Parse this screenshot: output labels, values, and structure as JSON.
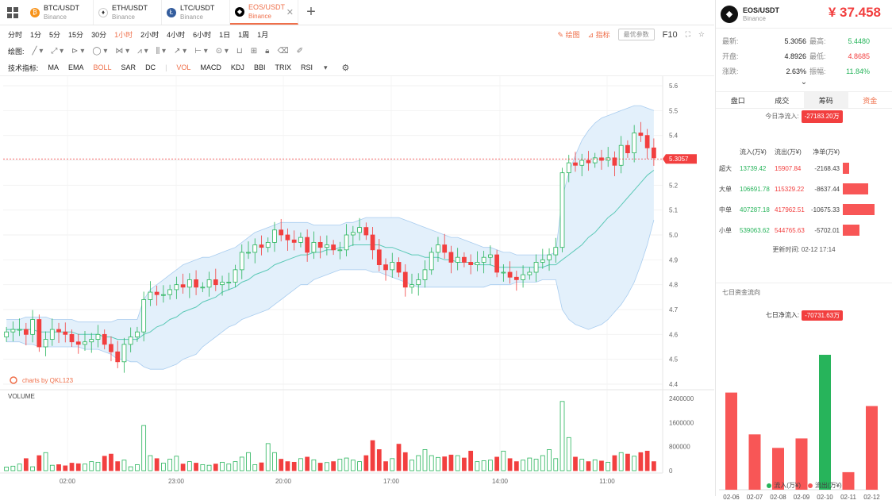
{
  "tabs": [
    {
      "symbol": "BTC/USDT",
      "exchange": "Binance",
      "coin": "₿",
      "color": "#f7931a"
    },
    {
      "symbol": "ETH/USDT",
      "exchange": "Binance",
      "coin": "♦",
      "color": "#ffffff"
    },
    {
      "symbol": "LTC/USDT",
      "exchange": "Binance",
      "coin": "Ł",
      "color": "#345d9d"
    },
    {
      "symbol": "EOS/USDT",
      "exchange": "Binance",
      "coin": "◆",
      "color": "#000000"
    }
  ],
  "intervals": [
    "分时",
    "1分",
    "5分",
    "15分",
    "30分",
    "1小时",
    "2小时",
    "4小时",
    "6小时",
    "1日",
    "1周",
    "1月"
  ],
  "active_interval": "1小时",
  "toolbar_right": {
    "draw": "绘图",
    "indicator": "指标",
    "pref": "最优参数",
    "f10": "F10"
  },
  "draw_label": "绘图:",
  "indicator_label": "技术指标:",
  "indicators": [
    "MA",
    "EMA",
    "BOLL",
    "SAR",
    "DC",
    "VOL",
    "MACD",
    "KDJ",
    "BBI",
    "TRIX",
    "RSI"
  ],
  "active_indicator": "BOLL",
  "chart_data": {
    "type": "candlestick",
    "y_ticks": [
      5.6,
      5.5,
      5.4,
      5.3,
      5.2,
      5.1,
      5.0,
      4.9,
      4.8,
      4.7,
      4.6,
      4.5,
      4.4
    ],
    "ylim": [
      4.4,
      5.6
    ],
    "x_ticks": [
      "02:00",
      "23:00",
      "20:00",
      "17:00",
      "14:00",
      "11:00"
    ],
    "current_price": "5.3057",
    "watermark": "charts by QKL123",
    "volume_label": "VOLUME",
    "volume_ticks": [
      "2400000",
      "1600000",
      "800000",
      "0"
    ],
    "volume_max": 2400000,
    "closes": [
      4.61,
      4.62,
      4.62,
      4.6,
      4.66,
      4.55,
      4.58,
      4.62,
      4.61,
      4.6,
      4.57,
      4.56,
      4.57,
      4.58,
      4.6,
      4.56,
      4.53,
      4.49,
      4.56,
      4.59,
      4.61,
      4.74,
      4.77,
      4.76,
      4.76,
      4.78,
      4.8,
      4.79,
      4.82,
      4.79,
      4.79,
      4.82,
      4.8,
      4.81,
      4.81,
      4.86,
      4.93,
      4.93,
      4.96,
      4.95,
      4.97,
      5.02,
      5.0,
      4.98,
      4.97,
      4.99,
      4.93,
      4.97,
      4.95,
      4.96,
      4.94,
      4.94,
      5.0,
      5.01,
      5.03,
      5.0,
      4.94,
      4.88,
      4.86,
      4.89,
      4.85,
      4.79,
      4.8,
      4.82,
      4.86,
      4.93,
      4.96,
      4.93,
      4.89,
      4.91,
      4.89,
      4.88,
      4.89,
      4.91,
      4.92,
      4.85,
      4.85,
      4.83,
      4.82,
      4.84,
      4.85,
      4.89,
      4.9,
      4.92,
      4.95,
      5.25,
      5.29,
      5.28,
      5.3,
      5.29,
      5.31,
      5.3,
      5.31,
      5.28,
      5.36,
      5.33,
      5.41,
      5.4,
      5.35,
      5.31
    ],
    "opens": [
      4.59,
      4.61,
      4.62,
      4.62,
      4.6,
      4.66,
      4.55,
      4.58,
      4.62,
      4.61,
      4.6,
      4.57,
      4.56,
      4.57,
      4.58,
      4.6,
      4.56,
      4.53,
      4.49,
      4.56,
      4.59,
      4.61,
      4.74,
      4.77,
      4.76,
      4.76,
      4.78,
      4.8,
      4.79,
      4.82,
      4.79,
      4.79,
      4.82,
      4.8,
      4.81,
      4.81,
      4.86,
      4.93,
      4.93,
      4.96,
      4.95,
      4.97,
      5.02,
      5.0,
      4.98,
      4.97,
      4.99,
      4.93,
      4.97,
      4.95,
      4.96,
      4.94,
      4.94,
      5.0,
      5.01,
      5.03,
      5.0,
      4.94,
      4.88,
      4.86,
      4.89,
      4.85,
      4.79,
      4.8,
      4.82,
      4.86,
      4.93,
      4.96,
      4.93,
      4.89,
      4.91,
      4.89,
      4.88,
      4.89,
      4.91,
      4.92,
      4.85,
      4.85,
      4.83,
      4.82,
      4.84,
      4.85,
      4.89,
      4.9,
      4.92,
      4.95,
      5.25,
      5.29,
      5.28,
      5.3,
      5.29,
      5.31,
      5.3,
      5.31,
      5.28,
      5.36,
      5.33,
      5.41,
      5.4,
      5.35
    ],
    "volumes": [
      120000,
      150000,
      220000,
      400000,
      130000,
      500000,
      600000,
      180000,
      200000,
      160000,
      250000,
      230000,
      220000,
      300000,
      280000,
      480000,
      550000,
      300000,
      350000,
      130000,
      200000,
      1500000,
      500000,
      400000,
      250000,
      380000,
      480000,
      220000,
      300000,
      250000,
      200000,
      180000,
      220000,
      280000,
      220000,
      300000,
      450000,
      600000,
      200000,
      260000,
      900000,
      600000,
      380000,
      300000,
      280000,
      400000,
      450000,
      360000,
      250000,
      270000,
      300000,
      380000,
      420000,
      350000,
      300000,
      500000,
      1000000,
      700000,
      300000,
      400000,
      880000,
      600000,
      350000,
      500000,
      700000,
      500000,
      440000,
      460000,
      520000,
      500000,
      420000,
      650000,
      300000,
      330000,
      350000,
      450000,
      650000,
      400000,
      300000,
      350000,
      420000,
      380000,
      500000,
      700000,
      400000,
      2300000,
      1100000,
      450000,
      380000,
      300000,
      360000,
      320000,
      280000,
      500000,
      600000,
      550000,
      480000,
      600000,
      650000,
      300000
    ],
    "boll_mid": [
      4.62,
      4.62,
      4.62,
      4.62,
      4.62,
      4.61,
      4.61,
      4.61,
      4.61,
      4.61,
      4.61,
      4.6,
      4.6,
      4.6,
      4.6,
      4.59,
      4.59,
      4.58,
      4.58,
      4.58,
      4.58,
      4.6,
      4.61,
      4.63,
      4.64,
      4.66,
      4.67,
      4.69,
      4.7,
      4.71,
      4.73,
      4.74,
      4.75,
      4.77,
      4.78,
      4.79,
      4.81,
      4.82,
      4.84,
      4.85,
      4.86,
      4.88,
      4.89,
      4.9,
      4.91,
      4.92,
      4.92,
      4.93,
      4.93,
      4.94,
      4.94,
      4.95,
      4.95,
      4.96,
      4.96,
      4.96,
      4.96,
      4.96,
      4.95,
      4.95,
      4.94,
      4.93,
      4.92,
      4.92,
      4.91,
      4.91,
      4.91,
      4.9,
      4.9,
      4.89,
      4.89,
      4.89,
      4.88,
      4.88,
      4.88,
      4.87,
      4.87,
      4.87,
      4.87,
      4.87,
      4.87,
      4.87,
      4.87,
      4.88,
      4.88,
      4.9,
      4.92,
      4.94,
      4.96,
      4.99,
      5.01,
      5.04,
      5.07,
      5.09,
      5.12,
      5.15,
      5.18,
      5.21,
      5.24,
      5.26
    ],
    "boll_upper": [
      4.66,
      4.66,
      4.66,
      4.67,
      4.67,
      4.67,
      4.67,
      4.66,
      4.66,
      4.66,
      4.66,
      4.65,
      4.65,
      4.65,
      4.65,
      4.65,
      4.65,
      4.66,
      4.66,
      4.66,
      4.66,
      4.74,
      4.78,
      4.8,
      4.82,
      4.84,
      4.86,
      4.88,
      4.89,
      4.9,
      4.91,
      4.91,
      4.92,
      4.93,
      4.94,
      4.95,
      4.97,
      4.99,
      5.01,
      5.02,
      5.03,
      5.04,
      5.05,
      5.05,
      5.05,
      5.05,
      5.05,
      5.04,
      5.04,
      5.04,
      5.04,
      5.04,
      5.05,
      5.05,
      5.06,
      5.07,
      5.07,
      5.07,
      5.07,
      5.07,
      5.07,
      5.06,
      5.05,
      5.04,
      5.03,
      5.02,
      5.01,
      5.0,
      4.99,
      4.99,
      4.98,
      4.97,
      4.96,
      4.95,
      4.95,
      4.94,
      4.93,
      4.93,
      4.92,
      4.92,
      4.92,
      4.92,
      4.92,
      4.92,
      4.93,
      5.15,
      5.25,
      5.32,
      5.38,
      5.42,
      5.45,
      5.47,
      5.48,
      5.49,
      5.5,
      5.51,
      5.52,
      5.52,
      5.51,
      5.5
    ],
    "boll_lower": [
      4.57,
      4.57,
      4.57,
      4.56,
      4.56,
      4.55,
      4.55,
      4.55,
      4.55,
      4.55,
      4.55,
      4.55,
      4.54,
      4.54,
      4.54,
      4.53,
      4.52,
      4.5,
      4.5,
      4.49,
      4.49,
      4.47,
      4.46,
      4.46,
      4.46,
      4.47,
      4.48,
      4.5,
      4.51,
      4.52,
      4.55,
      4.57,
      4.59,
      4.61,
      4.63,
      4.64,
      4.66,
      4.67,
      4.68,
      4.69,
      4.7,
      4.72,
      4.74,
      4.76,
      4.78,
      4.8,
      4.8,
      4.82,
      4.83,
      4.84,
      4.85,
      4.86,
      4.86,
      4.86,
      4.86,
      4.86,
      4.85,
      4.85,
      4.84,
      4.83,
      4.82,
      4.81,
      4.8,
      4.79,
      4.79,
      4.79,
      4.79,
      4.79,
      4.79,
      4.79,
      4.79,
      4.79,
      4.79,
      4.79,
      4.8,
      4.8,
      4.8,
      4.8,
      4.81,
      4.81,
      4.81,
      4.81,
      4.82,
      4.82,
      4.82,
      4.7,
      4.66,
      4.64,
      4.63,
      4.62,
      4.63,
      4.64,
      4.66,
      4.69,
      4.72,
      4.76,
      4.81,
      4.88,
      4.96,
      5.06
    ]
  },
  "right": {
    "symbol": "EOS/USDT",
    "exchange": "Binance",
    "price": "¥ 37.458",
    "stats": [
      {
        "k": "最新:",
        "v": "5.3056",
        "k2": "最高:",
        "v2": "5.4480",
        "c2": "green"
      },
      {
        "k": "开盘:",
        "v": "4.8926",
        "k2": "最低:",
        "v2": "4.8685",
        "c2": "red"
      },
      {
        "k": "涨跌:",
        "v": "2.63%",
        "vc": "green",
        "k2": "振幅:",
        "v2": "11.84%",
        "c2": "green"
      }
    ],
    "tabs": [
      "盘口",
      "成交",
      "筹码",
      "资金"
    ],
    "net_today_label": "今日净流入:",
    "net_today_value": "-27183.20万",
    "flow_headers": [
      "",
      "流入(万¥)",
      "流出(万¥)",
      "净单(万¥)"
    ],
    "flows": [
      {
        "name": "超大",
        "in": "13739.42",
        "out": "15907.84",
        "net": "-2168.43",
        "pct": 0.2
      },
      {
        "name": "大单",
        "in": "106691.78",
        "out": "115329.22",
        "net": "-8637.44",
        "pct": 0.81
      },
      {
        "name": "中单",
        "in": "407287.18",
        "out": "417962.51",
        "net": "-10675.33",
        "pct": 1.0
      },
      {
        "name": "小单",
        "in": "539063.62",
        "out": "544765.63",
        "net": "-5702.01",
        "pct": 0.53
      }
    ],
    "update_time": "更新时间: 02-12 17:14",
    "seven_title": "七日资金流向",
    "seven_net_label": "七日净流入:",
    "seven_net_value": "-70731.63万",
    "seven_days": {
      "type": "bar",
      "categories": [
        "02-06",
        "02-07",
        "02-08",
        "02-09",
        "02-10",
        "02-11",
        "02-12"
      ],
      "values": [
        0.72,
        0.41,
        0.31,
        0.38,
        1.0,
        0.13,
        0.62
      ],
      "colors": [
        "#f85656",
        "#f85656",
        "#f85656",
        "#f85656",
        "#27b45b",
        "#f85656",
        "#f85656"
      ]
    },
    "legend": {
      "in": "流入(万¥)",
      "out": "流出(万¥)"
    }
  }
}
